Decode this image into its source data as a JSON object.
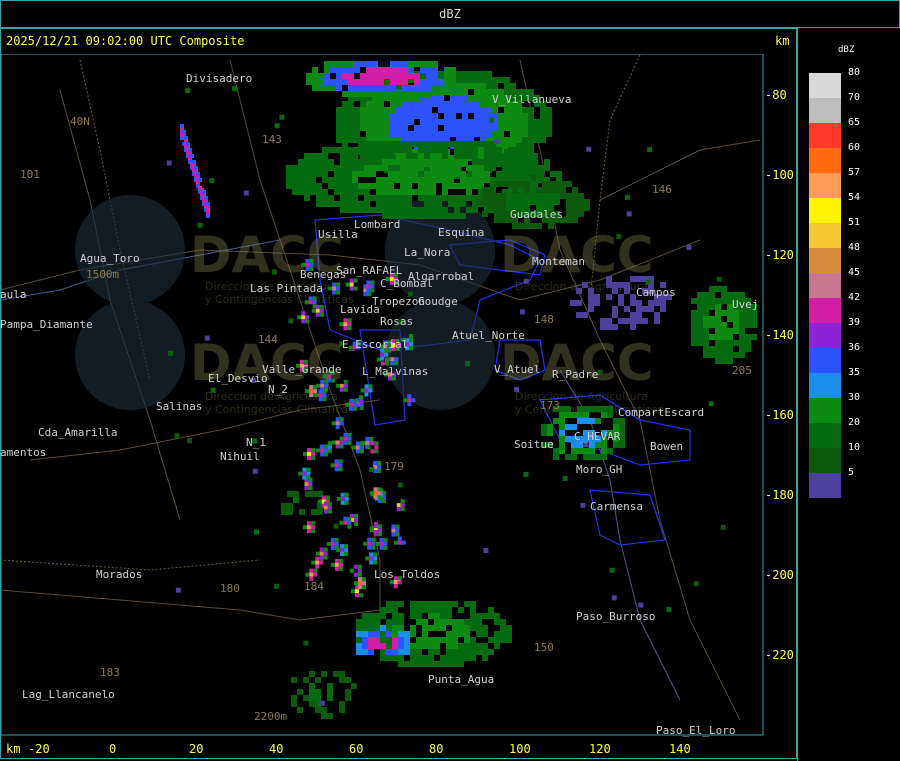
{
  "window": {
    "title": "dBZ"
  },
  "header": {
    "timestamp": "2025/12/21 09:02:00 UTC Composite",
    "km_top": "km",
    "km_bottom": "km"
  },
  "axes": {
    "x_ticks": [
      "-20",
      "0",
      "20",
      "40",
      "60",
      "80",
      "100",
      "120",
      "140"
    ],
    "y_ticks": [
      "-80",
      "-100",
      "-120",
      "-140",
      "-160",
      "-180",
      "-200",
      "-220"
    ]
  },
  "legend": {
    "title": "dBZ",
    "levels": [
      {
        "label": "80",
        "color": "#d8d8d8"
      },
      {
        "label": "70",
        "color": "#bdbdbd"
      },
      {
        "label": "65",
        "color": "#ff3a2a"
      },
      {
        "label": "60",
        "color": "#ff6a10"
      },
      {
        "label": "57",
        "color": "#ff9a5a"
      },
      {
        "label": "54",
        "color": "#fff400"
      },
      {
        "label": "51",
        "color": "#f5c431"
      },
      {
        "label": "48",
        "color": "#d68a3c"
      },
      {
        "label": "45",
        "color": "#c97790"
      },
      {
        "label": "42",
        "color": "#d21ea7"
      },
      {
        "label": "39",
        "color": "#8f23d6"
      },
      {
        "label": "36",
        "color": "#2d52ff"
      },
      {
        "label": "35",
        "color": "#1d8ee8"
      },
      {
        "label": "30",
        "color": "#0c8a12"
      },
      {
        "label": "20",
        "color": "#066a10"
      },
      {
        "label": "10",
        "color": "#0c5a0c"
      },
      {
        "label": "5",
        "color": "#4d3f9c"
      }
    ]
  },
  "places": [
    "Divisadero",
    "V_Villanueva",
    "Guadales",
    "Lombard",
    "Usilla",
    "La_Nora",
    "Esquina",
    "Agua_Toro",
    "1500m",
    "Las Pintada",
    "Benegas",
    "San_RAFAEL",
    "Algarrobal",
    "C_Bombal",
    "Tropezon",
    "Goudge",
    "Rosas",
    "Lavida",
    "Atuel_Norte",
    "E_Escorial",
    "El_Desvio",
    "Valle_Grande",
    "L_Malvinas",
    "V_Atuel",
    "R_Padre",
    "Salinas",
    "Cda_Amarilla",
    "amentos",
    "N_1",
    "N_2",
    "Nihuil",
    "Soitue",
    "CompartEscard",
    "C_HEVAR",
    "Bowen",
    "Moro_GH",
    "Carmensa",
    "Los_Toldos",
    "Morados",
    "Paso_Burroso",
    "Lag_Llancanelo",
    "Punta_Agua",
    "2200m",
    "Paso_El_Loro",
    "Pampa_Diamante",
    "aula",
    "Campos",
    "Uvej",
    "Monteman",
    "40N",
    "101",
    "146",
    "143",
    "144",
    "148",
    "150",
    "180",
    "184",
    "183",
    "205",
    "173",
    "179"
  ],
  "watermarks": [
    "DACC",
    "DACC",
    "DACC",
    "DACC"
  ],
  "watermark_sub": [
    "Direccion de Agricultura",
    "y Contingencias Climaticas"
  ]
}
